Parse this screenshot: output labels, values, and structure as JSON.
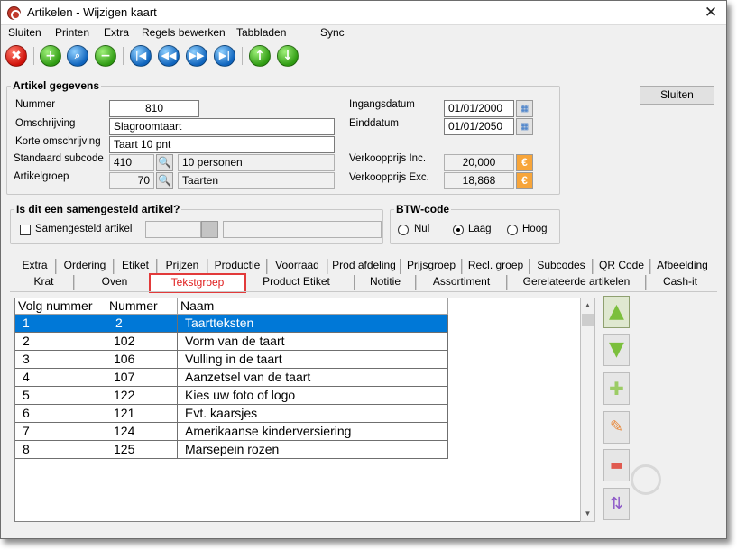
{
  "window": {
    "title": "Artikelen - Wijzigen kaart"
  },
  "menu": [
    "Sluiten",
    "Printen",
    "Extra",
    "Regels bewerken",
    "Tabbladen",
    "Sync"
  ],
  "toolbar": [
    {
      "icon": "close-icon",
      "glyph": "✖",
      "color": "#d0120a"
    },
    {
      "icon": "add-icon",
      "glyph": "+",
      "color": "#2f9b12"
    },
    {
      "icon": "search-icon",
      "glyph": "🔍",
      "color": "#2f9b12"
    },
    {
      "icon": "remove-icon",
      "glyph": "−",
      "color": "#2f9b12"
    },
    {
      "icon": "first-record-icon",
      "glyph": "⏮",
      "color": "#0f64bd"
    },
    {
      "icon": "previous-record-icon",
      "glyph": "⏪",
      "color": "#0f64bd"
    },
    {
      "icon": "next-record-icon",
      "glyph": "⏩",
      "color": "#0f64bd"
    },
    {
      "icon": "last-record-icon",
      "glyph": "⏭",
      "color": "#0f64bd"
    },
    {
      "icon": "arrow-up-icon",
      "glyph": "↑",
      "color": "#2f9b12"
    },
    {
      "icon": "arrow-down-icon",
      "glyph": "↓",
      "color": "#2f9b12"
    }
  ],
  "close_button": "Sluiten",
  "artikel": {
    "legend": "Artikel gegevens",
    "nummer_label": "Nummer",
    "nummer": "810",
    "omschrijving_label": "Omschrijving",
    "omschrijving": "Slagroomtaart",
    "korte_label": "Korte omschrijving",
    "korte": "Taart 10 pnt",
    "subcode_label": "Standaard subcode",
    "subcode": "410",
    "subcode_desc": "10 personen",
    "groep_label": "Artikelgroep",
    "groep": "70",
    "groep_desc": "Taarten",
    "ingang_label": "Ingangsdatum",
    "ingang": "01/01/2000",
    "eind_label": "Einddatum",
    "eind": "01/01/2050",
    "vk_inc_label": "Verkoopprijs Inc.",
    "vk_inc": "20,000",
    "vk_exc_label": "Verkoopprijs Exc.",
    "vk_exc": "18,868"
  },
  "samengesteld": {
    "legend": "Is dit een samengesteld artikel?",
    "checkbox_label": "Samengesteld artikel",
    "checked": false
  },
  "btw": {
    "legend": "BTW-code",
    "options": [
      "Nul",
      "Laag",
      "Hoog"
    ],
    "selected": "Laag"
  },
  "tabs_row1": [
    "Extra",
    "Ordering",
    "Etiket",
    "Prijzen",
    "Productie",
    "Voorraad",
    "Prod afdeling",
    "Prijsgroep",
    "Recl. groep",
    "Subcodes",
    "QR Code",
    "Afbeelding"
  ],
  "tabs_row2": [
    "Krat",
    "Oven",
    "Tekstgroep",
    "Product Etiket",
    "Notitie",
    "Assortiment",
    "Gerelateerde artikelen",
    "Cash-it"
  ],
  "active_tab": "Tekstgroep",
  "grid": {
    "columns": [
      "Volg nummer",
      "Nummer",
      "Naam"
    ],
    "rows": [
      [
        "1",
        "2",
        "Taartteksten"
      ],
      [
        "2",
        "102",
        "Vorm van de taart"
      ],
      [
        "3",
        "106",
        "Vulling in de taart"
      ],
      [
        "4",
        "107",
        "Aanzetsel van de taart"
      ],
      [
        "5",
        "122",
        "Kies uw foto of logo"
      ],
      [
        "6",
        "121",
        "Evt. kaarsjes"
      ],
      [
        "7",
        "124",
        "Amerikaanse kinderversiering"
      ],
      [
        "8",
        "125",
        "Marsepein rozen"
      ]
    ],
    "selected_row": 0
  },
  "side_buttons": [
    {
      "icon": "move-up-icon",
      "glyph": "▲",
      "color": "#7bbf3c"
    },
    {
      "icon": "move-down-icon",
      "glyph": "▼",
      "color": "#7bbf3c"
    },
    {
      "icon": "add-row-icon",
      "glyph": "✚",
      "color": "#9ccc65"
    },
    {
      "icon": "edit-row-icon",
      "glyph": "✎",
      "color": "#e8893c"
    },
    {
      "icon": "delete-row-icon",
      "glyph": "▬",
      "color": "#e05a50"
    },
    {
      "icon": "sort-az-icon",
      "glyph": "⇅",
      "color": "#8e5ac8"
    }
  ]
}
